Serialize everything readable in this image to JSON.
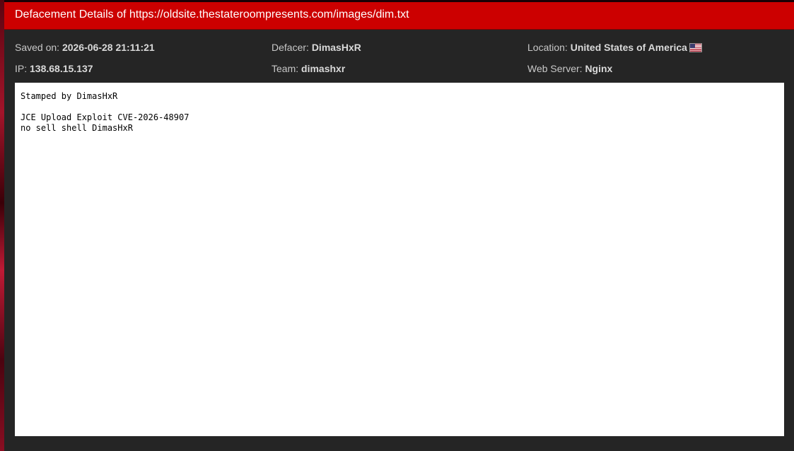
{
  "header": {
    "title": "Defacement Details of https://oldsite.thestateroompresents.com/images/dim.txt"
  },
  "info": {
    "saved_on_label": "Saved on: ",
    "saved_on_value": "2026-06-28 21:11:21",
    "defacer_label": "Defacer: ",
    "defacer_value": "DimasHxR",
    "location_label": "Location: ",
    "location_value": "United States of America",
    "location_flag_icon": "us-flag-icon",
    "ip_label": "IP: ",
    "ip_value": "138.68.15.137",
    "team_label": "Team: ",
    "team_value": "dimashxr",
    "webserver_label": "Web Server: ",
    "webserver_value": "Nginx"
  },
  "mirror": {
    "text": "Stamped by DimasHxR\n\nJCE Upload Exploit CVE-2026-48907\nno sell shell DimasHxR"
  },
  "colors": {
    "header_bg": "#cc0000",
    "panel_bg": "#252525",
    "content_bg": "#ffffff"
  }
}
